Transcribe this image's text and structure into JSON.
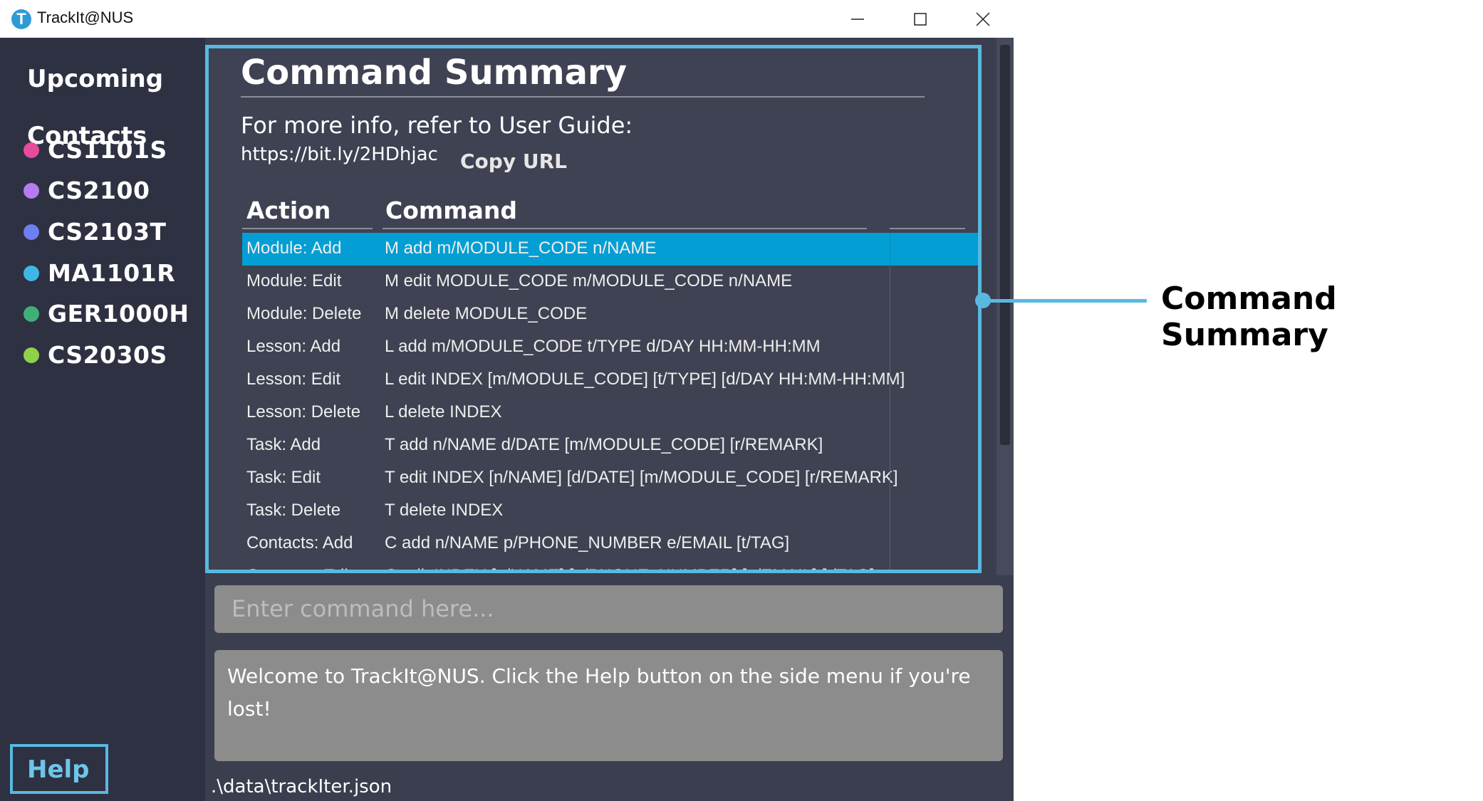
{
  "window": {
    "title": "TrackIt@NUS",
    "app_icon_letter": "T",
    "minimize_icon": "minimize-icon",
    "maximize_icon": "maximize-icon",
    "close_icon": "close-icon"
  },
  "sidebar": {
    "nav": [
      "Upcoming",
      "Contacts"
    ],
    "modules": [
      {
        "code": "CS1101S",
        "color": "#e64b9d"
      },
      {
        "code": "CS2100",
        "color": "#b57cf2"
      },
      {
        "code": "CS2103T",
        "color": "#6f7ef0"
      },
      {
        "code": "MA1101R",
        "color": "#3fb7e5"
      },
      {
        "code": "GER1000H",
        "color": "#3fb07a"
      },
      {
        "code": "CS2030S",
        "color": "#8fd14a"
      }
    ],
    "help_label": "Help"
  },
  "summary": {
    "title": "Command Summary",
    "info_text": "For more info, refer to User Guide:",
    "url": "https://bit.ly/2HDhjac",
    "copy_label": "Copy URL",
    "headers": {
      "action": "Action",
      "command": "Command"
    },
    "rows": [
      {
        "action": "Module: Add",
        "command": "M add m/MODULE_CODE n/NAME",
        "selected": true
      },
      {
        "action": "Module: Edit",
        "command": "M edit MODULE_CODE m/MODULE_CODE n/NAME"
      },
      {
        "action": "Module: Delete",
        "command": "M delete MODULE_CODE"
      },
      {
        "action": "Lesson: Add",
        "command": "L add m/MODULE_CODE t/TYPE d/DAY HH:MM-HH:MM"
      },
      {
        "action": "Lesson: Edit",
        "command": "L edit INDEX [m/MODULE_CODE] [t/TYPE] [d/DAY HH:MM-HH:MM]"
      },
      {
        "action": "Lesson: Delete",
        "command": "L delete INDEX"
      },
      {
        "action": "Task: Add",
        "command": "T add n/NAME d/DATE [m/MODULE_CODE] [r/REMARK]"
      },
      {
        "action": "Task: Edit",
        "command": "T edit INDEX [n/NAME] [d/DATE] [m/MODULE_CODE] [r/REMARK]"
      },
      {
        "action": "Task: Delete",
        "command": "T delete INDEX"
      },
      {
        "action": "Contacts: Add",
        "command": "C add n/NAME p/PHONE_NUMBER e/EMAIL [t/TAG]"
      },
      {
        "action": "Contacts: Edit",
        "command": "C edit INDEX [n/NAME] [p/PHONE_NUMBER] [e/EMAIL] [t/TAG]"
      }
    ]
  },
  "command_box": {
    "placeholder": "Enter command here..."
  },
  "result_box": {
    "text": "Welcome to TrackIt@NUS. Click the Help button on the side menu if you're lost!"
  },
  "status_bar": {
    "path": ".\\data\\trackIter.json"
  },
  "annotation": {
    "label": "Command Summary",
    "color": "#58b9e0"
  }
}
